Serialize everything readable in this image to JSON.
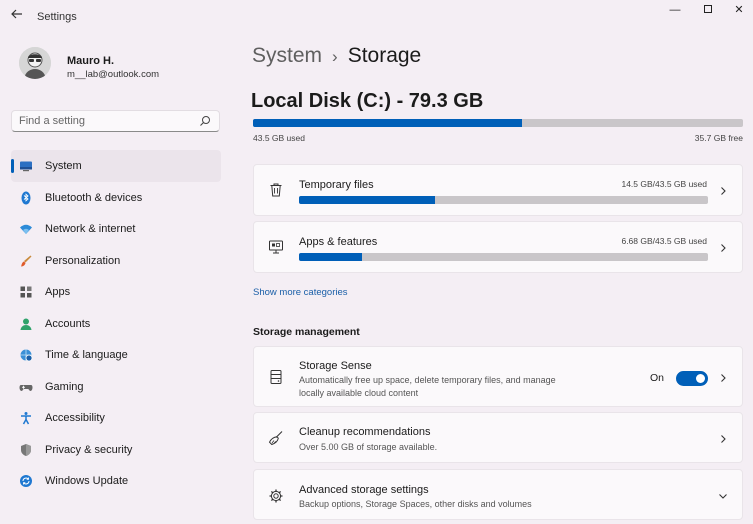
{
  "window": {
    "title": "Settings",
    "minimize": "—",
    "close": "✕"
  },
  "profile": {
    "name": "Mauro H.",
    "email": "m__lab@outlook.com"
  },
  "search": {
    "placeholder": "Find a setting"
  },
  "sidebar": {
    "items": [
      {
        "label": "System",
        "icon": "monitor-icon",
        "active": true
      },
      {
        "label": "Bluetooth & devices",
        "icon": "bluetooth-icon"
      },
      {
        "label": "Network & internet",
        "icon": "wifi-icon"
      },
      {
        "label": "Personalization",
        "icon": "brush-icon"
      },
      {
        "label": "Apps",
        "icon": "apps-icon"
      },
      {
        "label": "Accounts",
        "icon": "person-icon"
      },
      {
        "label": "Time & language",
        "icon": "globe-clock-icon"
      },
      {
        "label": "Gaming",
        "icon": "gamepad-icon"
      },
      {
        "label": "Accessibility",
        "icon": "accessibility-icon"
      },
      {
        "label": "Privacy & security",
        "icon": "shield-icon"
      },
      {
        "label": "Windows Update",
        "icon": "update-icon"
      }
    ]
  },
  "breadcrumb": {
    "parent": "System",
    "separator": "›",
    "current": "Storage"
  },
  "disk": {
    "title": "Local Disk (C:) - 79.3 GB",
    "used_label": "43.5 GB used",
    "free_label": "35.7 GB free",
    "used_fraction": 0.549
  },
  "categories": [
    {
      "title": "Temporary files",
      "amount": "14.5 GB/43.5 GB used",
      "fraction": 0.333,
      "icon": "trash-icon"
    },
    {
      "title": "Apps & features",
      "amount": "6.68 GB/43.5 GB used",
      "fraction": 0.154,
      "icon": "apps-features-icon"
    }
  ],
  "show_more": "Show more categories",
  "management": {
    "title": "Storage management",
    "storage_sense": {
      "title": "Storage Sense",
      "description": "Automatically free up space, delete temporary files, and manage locally available cloud content",
      "toggle_label": "On",
      "enabled": true
    },
    "cleanup": {
      "title": "Cleanup recommendations",
      "description": "Over 5.00 GB of storage available."
    },
    "advanced": {
      "title": "Advanced storage settings",
      "description": "Backup options, Storage Spaces, other disks and volumes"
    }
  },
  "colors": {
    "accent": "#005fb8",
    "background": "#f4eef4",
    "bar_track": "#c9c6c9"
  }
}
